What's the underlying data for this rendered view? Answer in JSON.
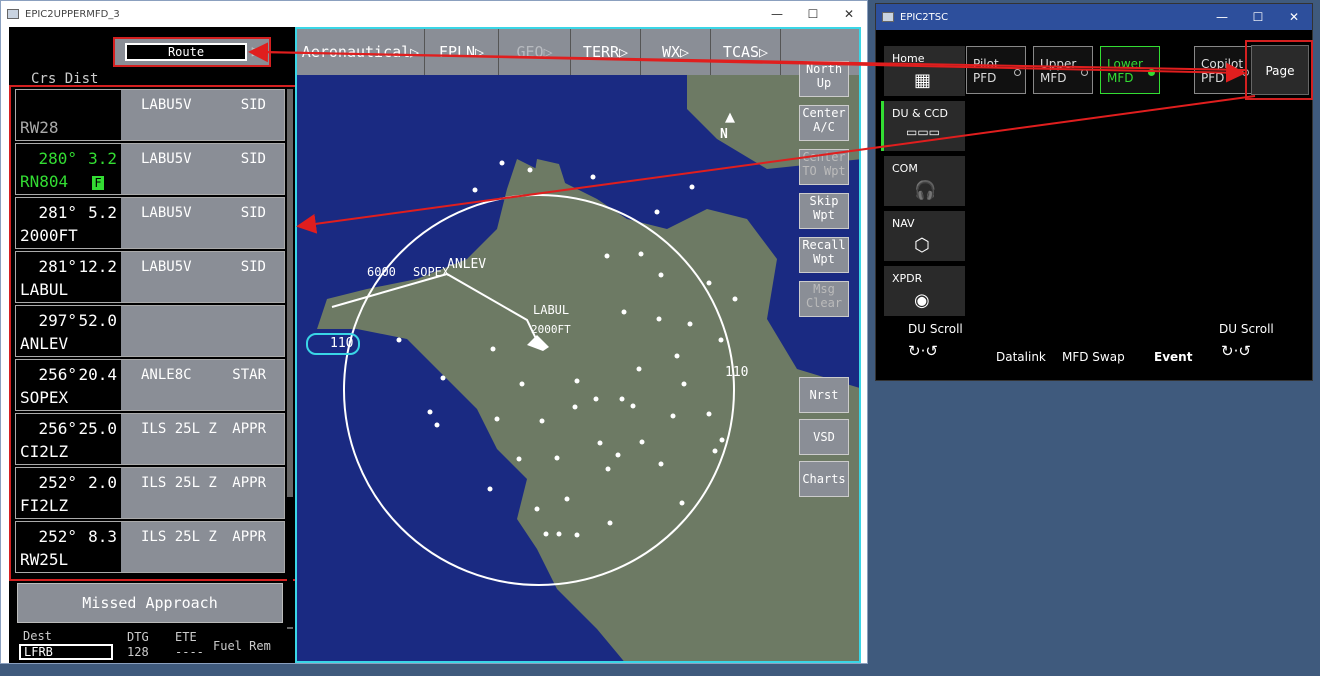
{
  "mfd_window": {
    "title": "EPIC2UPPERMFD_3",
    "route_label": "Route",
    "header_crs_dist": "Crs  Dist",
    "rows": [
      {
        "crs": "",
        "dist": "",
        "name": "RW28",
        "proc": "LABU5V",
        "type": "SID",
        "highlight": false,
        "dim_name": true
      },
      {
        "crs": "280°",
        "dist": "3.2",
        "name": "RN804",
        "proc": "LABU5V",
        "type": "SID",
        "highlight": true,
        "badge": "F"
      },
      {
        "crs": "281°",
        "dist": "5.2",
        "name": "2000FT",
        "proc": "LABU5V",
        "type": "SID",
        "highlight": false
      },
      {
        "crs": "281°",
        "dist": "12.2",
        "name": "LABUL",
        "proc": "LABU5V",
        "type": "SID",
        "highlight": false
      },
      {
        "crs": "297°",
        "dist": "52.0",
        "name": "ANLEV",
        "proc": "",
        "type": "",
        "highlight": false
      },
      {
        "crs": "256°",
        "dist": "20.4",
        "name": "SOPEX",
        "proc": "ANLE8C",
        "type": "STAR",
        "highlight": false
      },
      {
        "crs": "256°",
        "dist": "25.0",
        "name": "CI2LZ",
        "proc": "ILS 25L Z",
        "type": "APPR",
        "highlight": false
      },
      {
        "crs": "252°",
        "dist": "2.0",
        "name": "FI2LZ",
        "proc": "ILS 25L Z",
        "type": "APPR",
        "highlight": false
      },
      {
        "crs": "252°",
        "dist": "8.3",
        "name": "RW25L",
        "proc": "ILS 25L Z",
        "type": "APPR",
        "highlight": false
      }
    ],
    "missed_approach": "Missed Approach",
    "footer": {
      "dest_label": "Dest",
      "dest_value": "LFRB",
      "dtg_label": "DTG",
      "dtg_value": "128",
      "ete_label": "ETE",
      "ete_value": "----",
      "fuel_label": "Fuel Rem"
    },
    "tabs": [
      "Aeronautical",
      "FPLN",
      "GEO",
      "TERR",
      "WX",
      "TCAS"
    ],
    "side_buttons": [
      "North Up",
      "Center A/C",
      "Center TO Wpt",
      "Skip Wpt",
      "Recall Wpt",
      "Msg Clear",
      "Nrst",
      "VSD",
      "Charts"
    ],
    "map": {
      "range_label": "110",
      "range_ring_label": "110",
      "north_label": "N",
      "waypoints": [
        "ANLEV",
        "SOPEX",
        "6000",
        "LABUL",
        "2000FT"
      ]
    }
  },
  "tsc_window": {
    "title": "EPIC2TSC",
    "nav": [
      {
        "label": "Home",
        "icon": "grid-icon"
      },
      {
        "label": "DU & CCD",
        "icon": "display-units-icon"
      },
      {
        "label": "COM",
        "icon": "headset-icon"
      },
      {
        "label": "NAV",
        "icon": "nav-hexagon-icon"
      },
      {
        "label": "XPDR",
        "icon": "transponder-icon"
      }
    ],
    "du_buttons": [
      {
        "l1": "Pilot",
        "l2": "PFD",
        "active": false
      },
      {
        "l1": "Upper",
        "l2": "MFD",
        "active": false
      },
      {
        "l1": "Lower",
        "l2": "MFD",
        "active": true
      },
      {
        "l1": "Copilot",
        "l2": "PFD",
        "active": false
      }
    ],
    "page_label": "Page",
    "du_scroll_left": "DU Scroll",
    "du_scroll_right": "DU Scroll",
    "datalink": "Datalink",
    "mfd_swap": "MFD Swap",
    "event": "Event"
  }
}
